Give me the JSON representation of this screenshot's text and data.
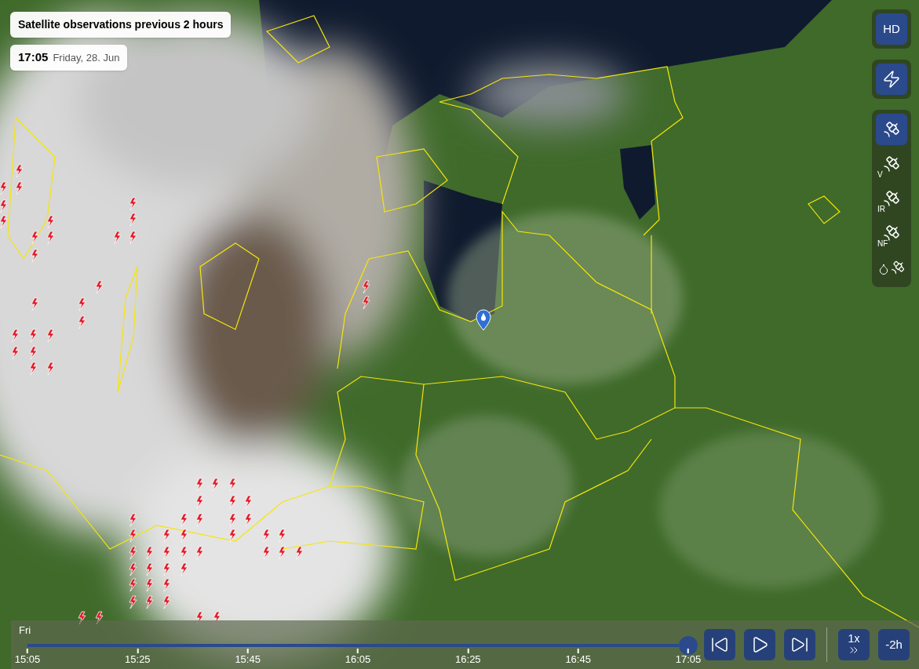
{
  "header": {
    "title": "Satellite observations previous 2 hours",
    "time": "17:05",
    "date": "Friday, 28. Jun"
  },
  "toolbar": {
    "hd": {
      "label": "HD",
      "selected": true
    },
    "lightning": {
      "selected": true
    },
    "layers": [
      {
        "kind": "satellite",
        "selected": true
      },
      {
        "kind": "satellite",
        "badge": "V",
        "selected": false
      },
      {
        "kind": "satellite",
        "badge": "IR",
        "selected": false
      },
      {
        "kind": "satellite",
        "badge": "NF",
        "selected": false
      },
      {
        "kind": "rain",
        "selected": false
      }
    ]
  },
  "timeline": {
    "day": "Fri",
    "level": 1,
    "ticks": [
      "15:05",
      "15:25",
      "15:45",
      "16:05",
      "16:25",
      "16:45",
      "17:05"
    ],
    "speed": "1x",
    "offset": "-2h"
  }
}
